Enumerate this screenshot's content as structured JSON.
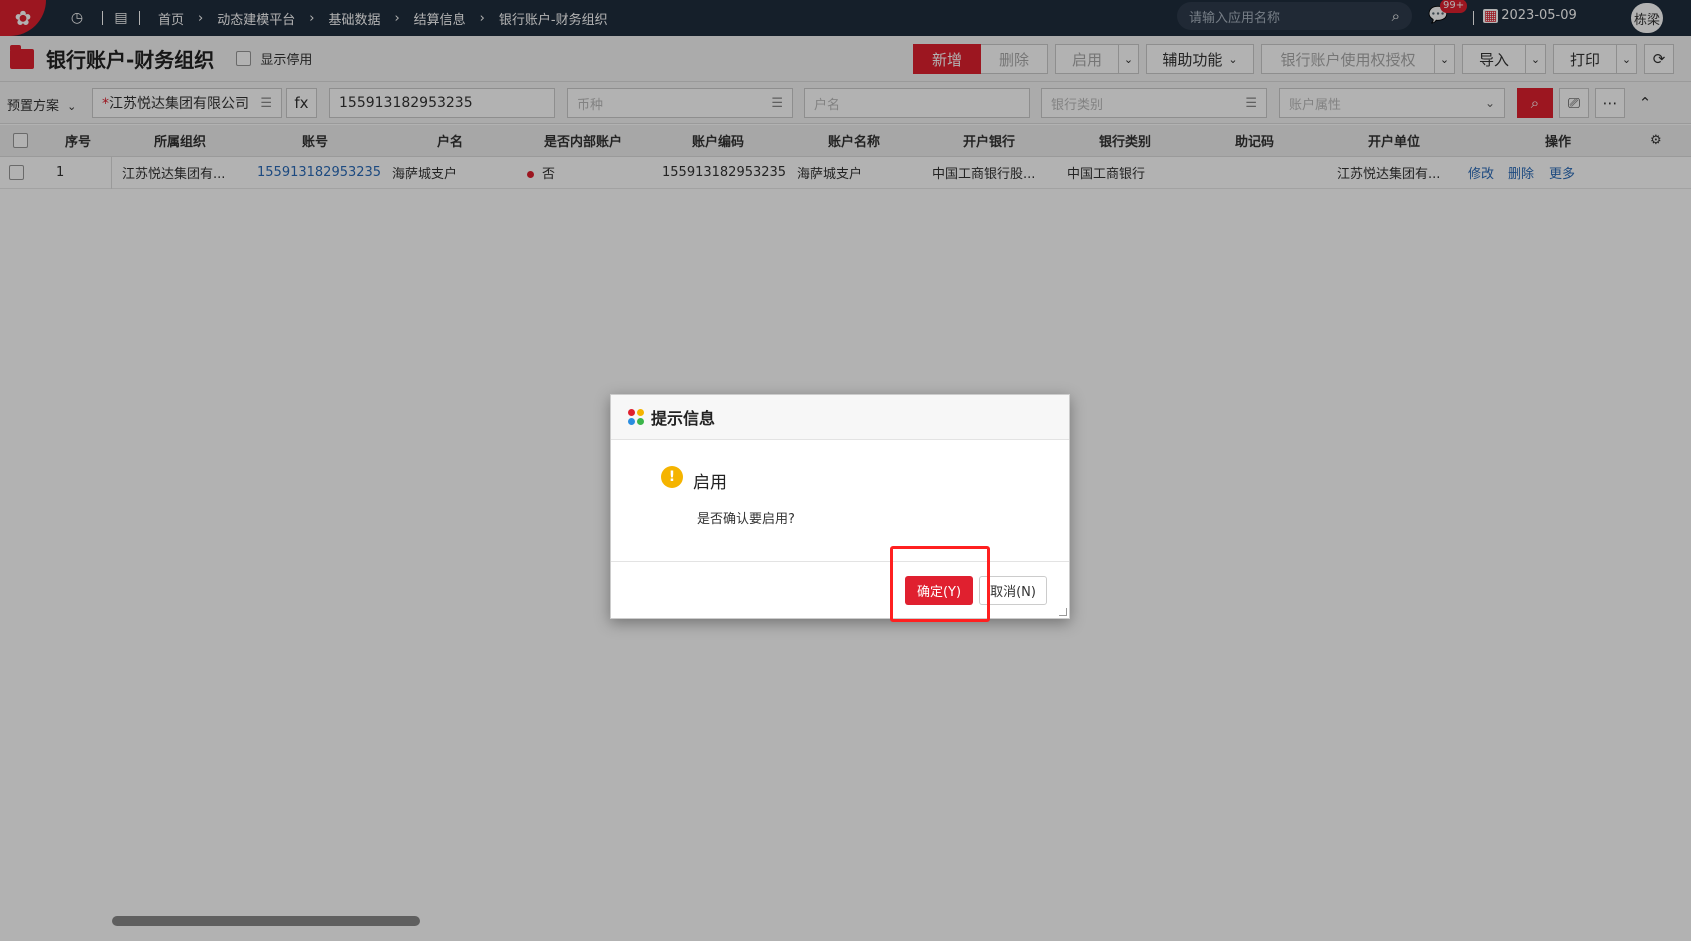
{
  "nav": {
    "breadcrumbs": [
      "首页",
      "动态建模平台",
      "基础数据",
      "结算信息",
      "银行账户-财务组织"
    ],
    "search_placeholder": "请输入应用名称",
    "msg_badge": "99+",
    "date": "2023-05-09",
    "user": "栋梁"
  },
  "page": {
    "title": "银行账户-财务组织",
    "show_disabled_label": "显示停用"
  },
  "toolbar": {
    "add": "新增",
    "delete": "删除",
    "enable": "启用",
    "assist": "辅助功能",
    "auth": "银行账户使用权授权",
    "import": "导入",
    "print": "打印"
  },
  "filters": {
    "preset": "预置方案",
    "org_value": "江苏悦达集团有限公司",
    "fx": "fx",
    "account_value": "155913182953235",
    "currency_ph": "币种",
    "holder_ph": "户名",
    "bank_type_ph": "银行类别",
    "attr_ph": "账户属性"
  },
  "table": {
    "headers": [
      "序号",
      "所属组织",
      "账号",
      "户名",
      "是否内部账户",
      "账户编码",
      "账户名称",
      "开户银行",
      "银行类别",
      "助记码",
      "开户单位",
      "操作"
    ],
    "rows": [
      {
        "seq": "1",
        "org": "江苏悦达集团有...",
        "account": "155913182953235",
        "holder": "海萨城支户",
        "internal": "否",
        "code": "155913182953235",
        "name": "海萨城支户",
        "bank": "中国工商银行股...",
        "bank_type": "中国工商银行",
        "mnemonic": "",
        "unit": "江苏悦达集团有...",
        "op_edit": "修改",
        "op_delete": "删除",
        "op_more": "更多"
      }
    ]
  },
  "dialog": {
    "title": "提示信息",
    "heading": "启用",
    "message": "是否确认要启用?",
    "ok": "确定(Y)",
    "cancel": "取消(N)"
  },
  "colors": {
    "brand_red": "#e0202f",
    "nav_bg": "#1f2d3d",
    "link": "#2a6bb8",
    "warn": "#f5b400"
  }
}
